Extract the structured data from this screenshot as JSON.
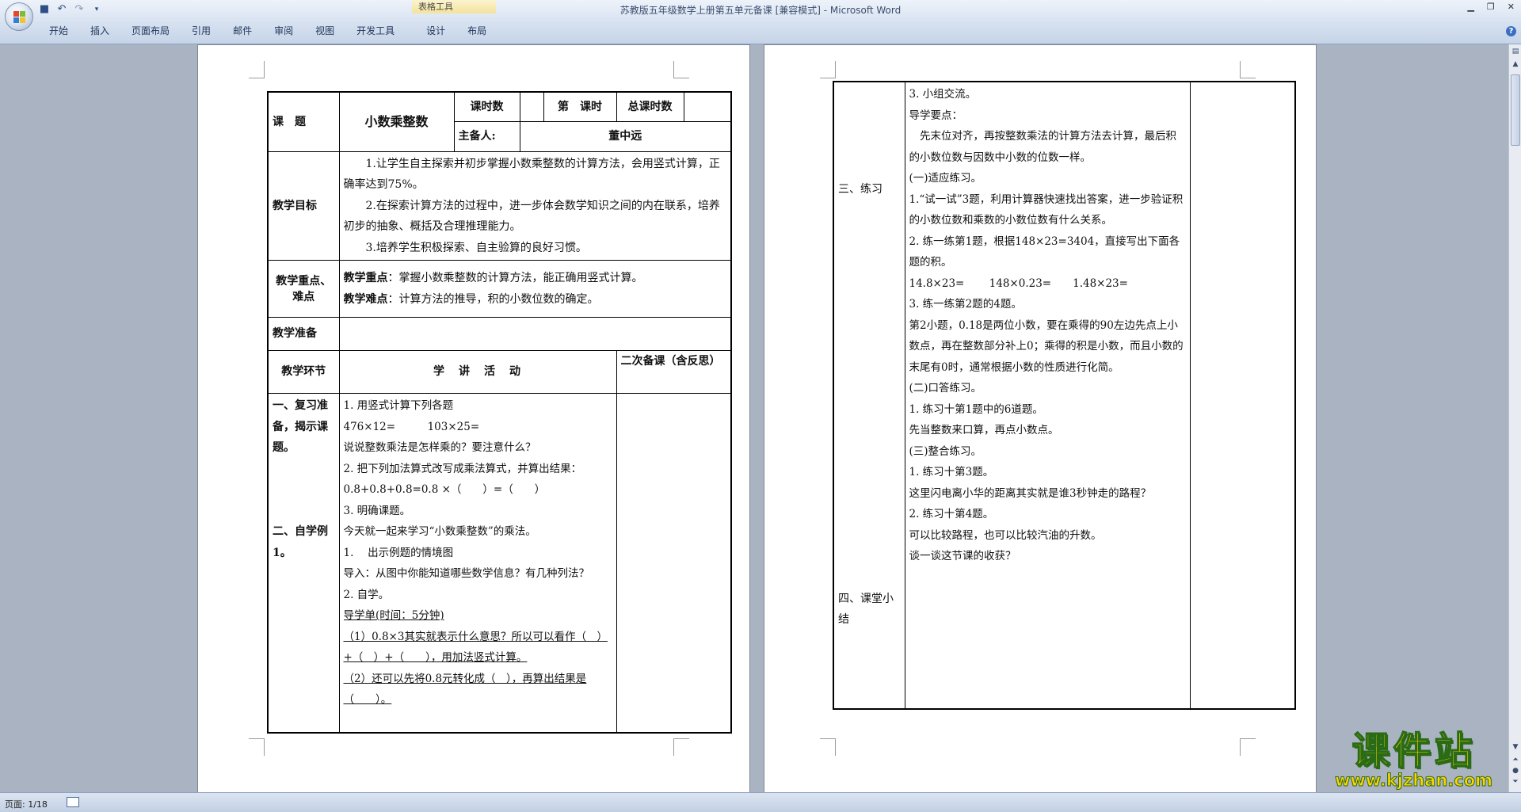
{
  "window": {
    "title": "苏教版五年级数学上册第五单元备课 [兼容模式] - Microsoft Word",
    "context_tab": "表格工具"
  },
  "ribbon": {
    "tabs": [
      "开始",
      "插入",
      "页面布局",
      "引用",
      "邮件",
      "审阅",
      "视图",
      "开发工具",
      "设计",
      "布局"
    ]
  },
  "status_bar": {
    "page": "页面: 1/18"
  },
  "watermark": {
    "text": "课件站",
    "url": "www.kjzhan.com"
  },
  "page1": {
    "header": {
      "topic_label": "课　题",
      "topic_value": "小数乘整数",
      "period_label": "课时数",
      "nth_label": "第　课时",
      "total_label": "总课时数",
      "preparer_label": "主备人:",
      "preparer_value": "董中远"
    },
    "goals_label": "教学目标",
    "goals": [
      "　　1.让学生自主探索并初步掌握小数乘整数的计算方法，会用竖式计算，正确率达到75%。",
      "　　2.在探索计算方法的过程中，进一步体会数学知识之间的内在联系，培养初步的抽象、概括及合理推理能力。",
      "　　3.培养学生积极探索、自主验算的良好习惯。"
    ],
    "keypoints_label": "教学重点、难点",
    "keypoint_label": "教学重点",
    "keypoint_text": "：掌握小数乘整数的计算方法，能正确用竖式计算。",
    "difficulty_label": "教学难点",
    "difficulty_text": "：计算方法的推导，积的小数位数的确定。",
    "prep_label": "教学准备",
    "section_header": {
      "stage": "教学环节",
      "activity": "学　讲　活　动",
      "notes": "二次备课（含反思）"
    },
    "stages": [
      "一、复习准备，揭示课题。",
      "二、自学例1。"
    ],
    "activities": [
      "1. 用竖式计算下列各题",
      "476×12=　　　103×25=",
      "说说整数乘法是怎样乘的？要注意什么？",
      "2. 把下列加法算式改写成乘法算式，并算出结果：",
      "0.8+0.8+0.8=0.8 ×（　　）=（　　）",
      "3. 明确课题。",
      "今天就一起来学习“小数乘整数”的乘法。",
      "1.　 出示例题的情境图",
      "导入：从图中你能知道哪些数学信息？有几种列法？",
      "2. 自学。",
      "导学单(时间：5分钟)",
      "（1）0.8×3其实就表示什么意思？所以可以看作（　）+（　）+（　　），用加法竖式计算。",
      "（2）还可以先将0.8元转化成（　），再算出结果是（　　）。"
    ]
  },
  "page2": {
    "stages": [
      "三、练习",
      "四、课堂小结"
    ],
    "activities": [
      "3. 小组交流。",
      "导学要点：",
      "　先末位对齐，再按整数乘法的计算方法去计算，最后积的小数位数与因数中小数的位数一样。",
      "(一)适应练习。",
      "1.“试一试”3题，利用计算器快速找出答案，进一步验证积的小数位数和乘数的小数位数有什么关系。",
      "2. 练一练第1题，根据148×23=3404，直接写出下面各题的积。",
      "14.8×23=　　 148×0.23=　　1.48×23=",
      "3. 练一练第2题的4题。",
      "第2小题，0.18是两位小数，要在乘得的90左边先点上小数点，再在整数部分补上0；乘得的积是小数，而且小数的末尾有0时，通常根据小数的性质进行化简。",
      "(二)口答练习。",
      "1. 练习十第1题中的6道题。",
      "先当整数来口算，再点小数点。",
      "(三)整合练习。",
      "1. 练习十第3题。",
      "这里闪电离小华的距离其实就是谁3秒钟走的路程？",
      "2. 练习十第4题。",
      "可以比较路程，也可以比较汽油的升数。",
      "谈一谈这节课的收获？"
    ]
  }
}
